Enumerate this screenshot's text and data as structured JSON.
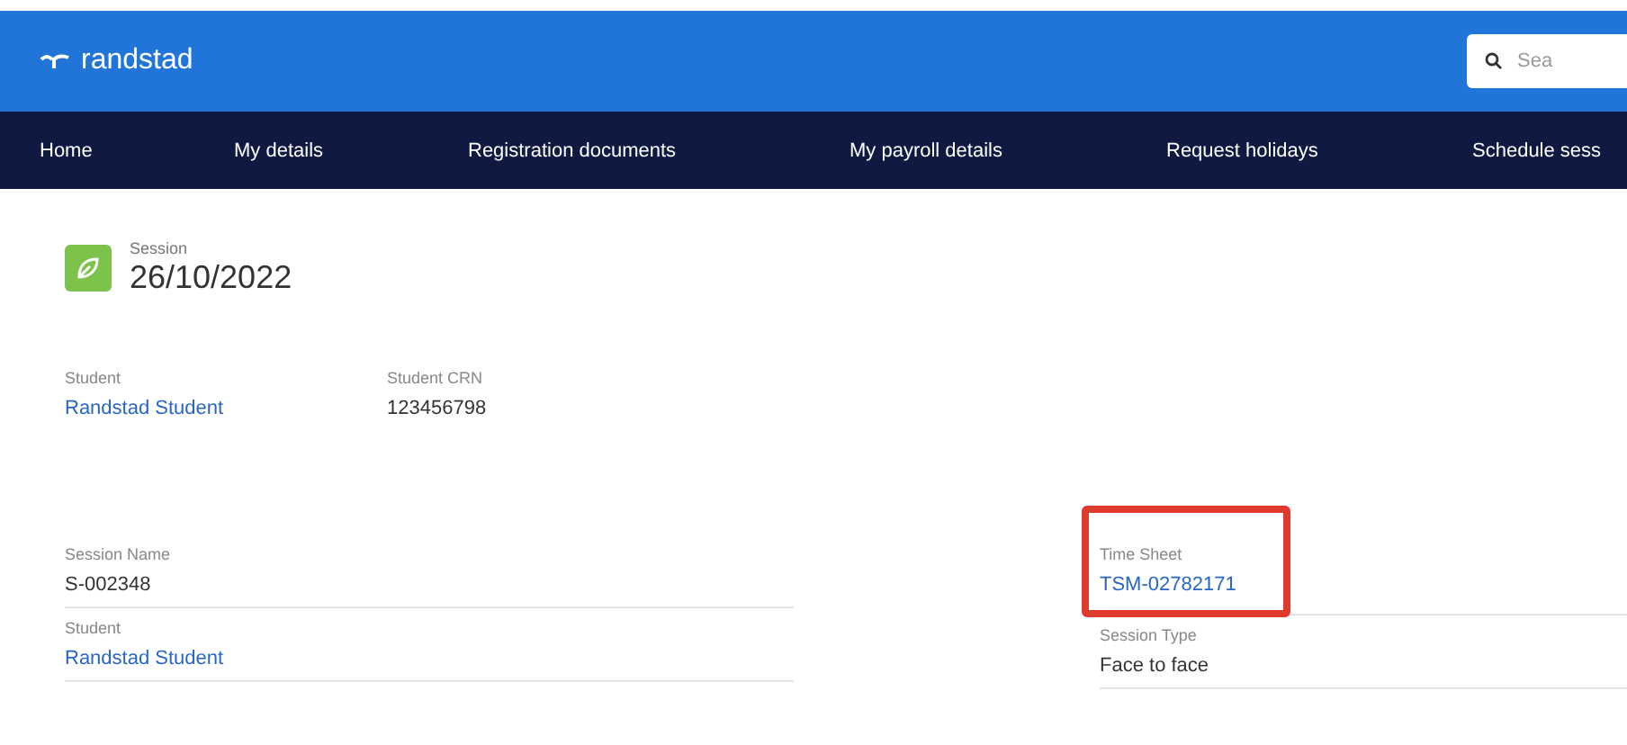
{
  "brand": {
    "name": "randstad"
  },
  "search": {
    "placeholder": "Sea"
  },
  "nav": [
    {
      "label": "Home"
    },
    {
      "label": "My details"
    },
    {
      "label": "Registration documents"
    },
    {
      "label": "My payroll details"
    },
    {
      "label": "Request holidays"
    },
    {
      "label": "Schedule sess"
    }
  ],
  "record": {
    "type": "Session",
    "title": "26/10/2022"
  },
  "highlights": [
    {
      "label": "Student",
      "value": "Randstad Student",
      "kind": "link"
    },
    {
      "label": "Student CRN",
      "value": "123456798",
      "kind": "text"
    }
  ],
  "details_left": [
    {
      "label": "Session Name",
      "value": "S-002348",
      "kind": "text"
    },
    {
      "label": "Student",
      "value": "Randstad Student",
      "kind": "link"
    }
  ],
  "details_right": [
    {
      "label": "Time Sheet",
      "value": "TSM-02782171",
      "kind": "link",
      "highlighted": true
    },
    {
      "label": "Session Type",
      "value": "Face to face",
      "kind": "text",
      "highlighted": false
    }
  ]
}
